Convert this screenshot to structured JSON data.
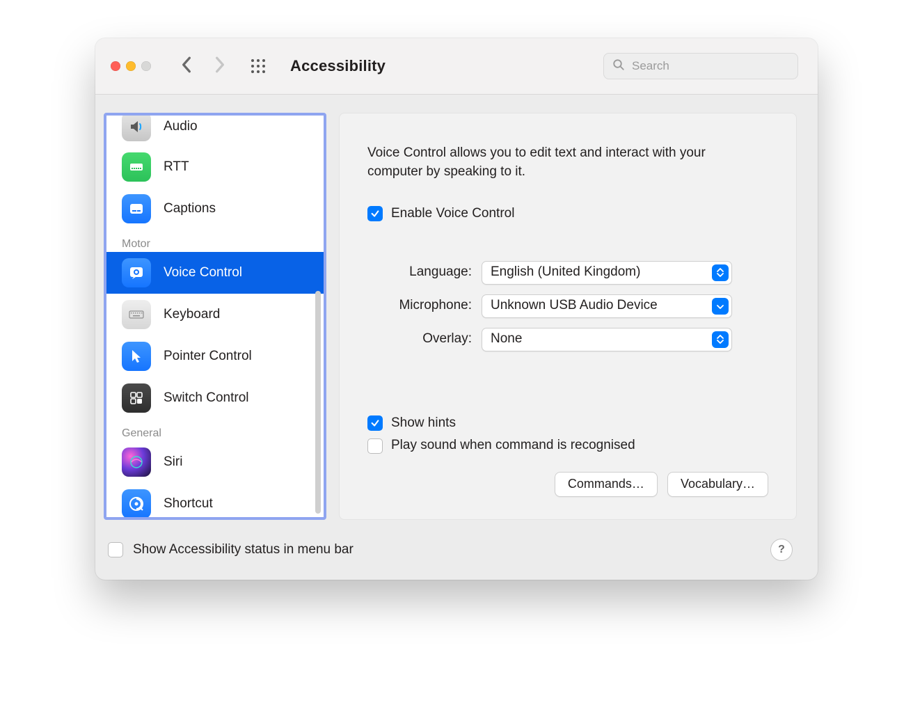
{
  "toolbar": {
    "title": "Accessibility",
    "search_placeholder": "Search"
  },
  "sidebar": {
    "items": [
      {
        "label": "Audio"
      },
      {
        "label": "RTT"
      },
      {
        "label": "Captions"
      }
    ],
    "header_motor": "Motor",
    "motor_items": [
      {
        "label": "Voice Control"
      },
      {
        "label": "Keyboard"
      },
      {
        "label": "Pointer Control"
      },
      {
        "label": "Switch Control"
      }
    ],
    "header_general": "General",
    "general_items": [
      {
        "label": "Siri"
      },
      {
        "label": "Shortcut"
      }
    ]
  },
  "panel": {
    "description": "Voice Control allows you to edit text and interact with your computer by speaking to it.",
    "enable_label": "Enable Voice Control",
    "form": {
      "language_label": "Language:",
      "language_value": "English (United Kingdom)",
      "microphone_label": "Microphone:",
      "microphone_value": "Unknown USB Audio Device",
      "overlay_label": "Overlay:",
      "overlay_value": "None"
    },
    "show_hints_label": "Show hints",
    "play_sound_label": "Play sound when command is recognised",
    "commands_button": "Commands…",
    "vocabulary_button": "Vocabulary…"
  },
  "footer": {
    "status_label": "Show Accessibility status in menu bar",
    "help": "?"
  }
}
